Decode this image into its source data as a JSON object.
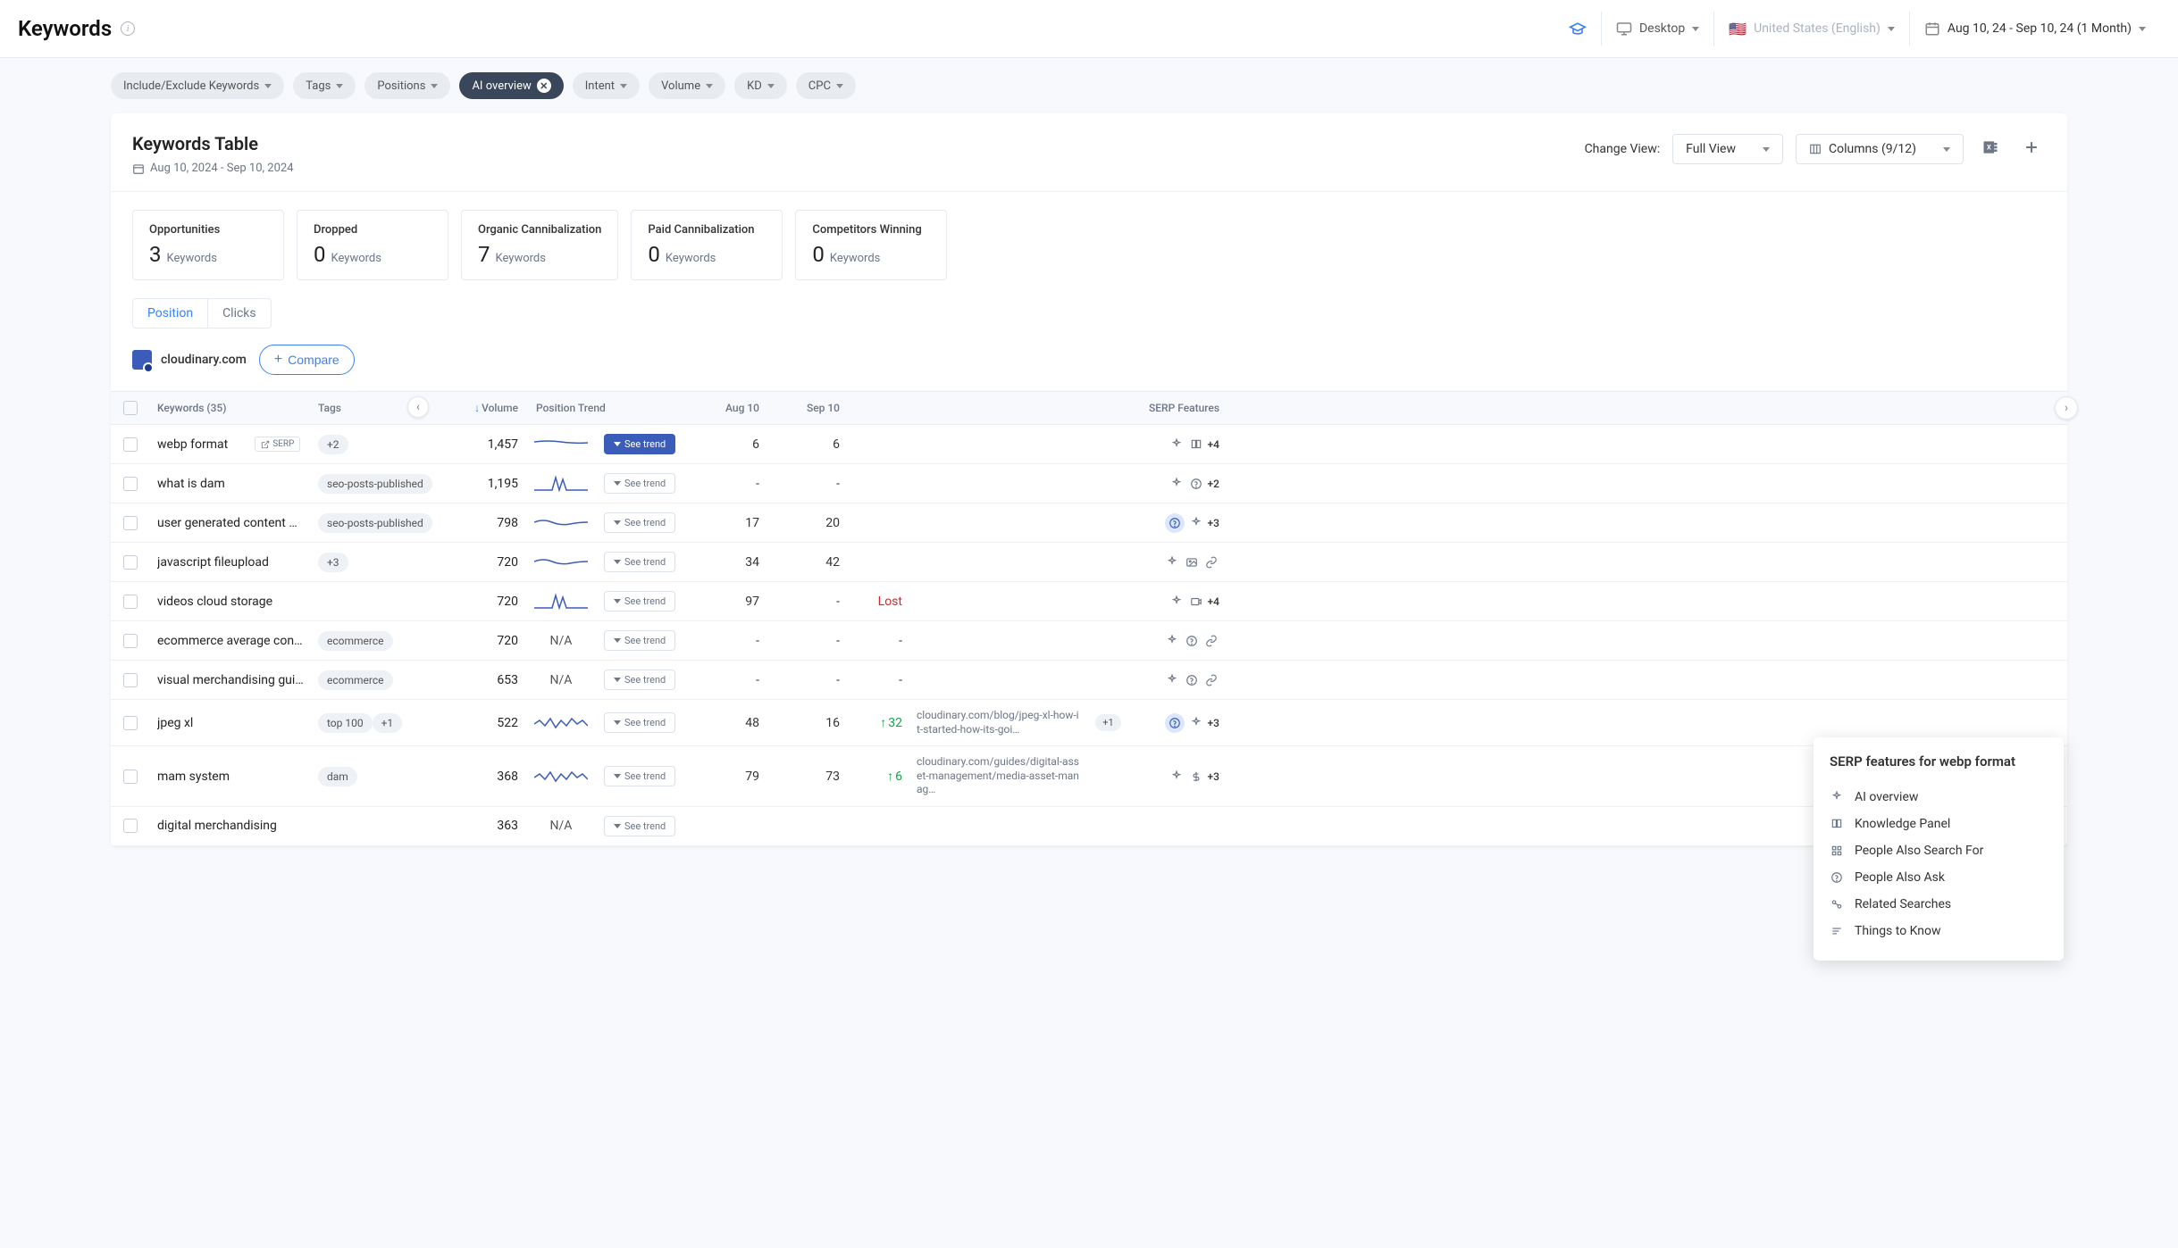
{
  "header": {
    "title": "Keywords",
    "device": "Desktop",
    "locale": "United States (English)",
    "dateRange": "Aug 10, 24 - Sep 10, 24 (1 Month)"
  },
  "filters": [
    {
      "label": "Include/Exclude Keywords",
      "active": false,
      "dropdown": true
    },
    {
      "label": "Tags",
      "active": false,
      "dropdown": true
    },
    {
      "label": "Positions",
      "active": false,
      "dropdown": true
    },
    {
      "label": "AI overview",
      "active": true,
      "dropdown": false
    },
    {
      "label": "Intent",
      "active": false,
      "dropdown": true
    },
    {
      "label": "Volume",
      "active": false,
      "dropdown": true
    },
    {
      "label": "KD",
      "active": false,
      "dropdown": true
    },
    {
      "label": "CPC",
      "active": false,
      "dropdown": true
    }
  ],
  "panel": {
    "title": "Keywords Table",
    "dateRange": "Aug 10, 2024 - Sep 10, 2024",
    "changeViewLabel": "Change View:",
    "viewMode": "Full View",
    "columnsLabel": "Columns (9/12)"
  },
  "stats": [
    {
      "label": "Opportunities",
      "value": "3",
      "unit": "Keywords"
    },
    {
      "label": "Dropped",
      "value": "0",
      "unit": "Keywords"
    },
    {
      "label": "Organic Cannibalization",
      "value": "7",
      "unit": "Keywords"
    },
    {
      "label": "Paid Cannibalization",
      "value": "0",
      "unit": "Keywords"
    },
    {
      "label": "Competitors Winning",
      "value": "0",
      "unit": "Keywords"
    }
  ],
  "tabs": {
    "position": "Position",
    "clicks": "Clicks"
  },
  "domain": {
    "name": "cloudinary.com",
    "compareLabel": "Compare"
  },
  "columns": {
    "keywords": "Keywords (35)",
    "tags": "Tags",
    "volume": "Volume",
    "positionTrend": "Position Trend",
    "aug": "Aug 10",
    "sep": "Sep 10",
    "serpFeatures": "SERP Features"
  },
  "seeTrendLabel": "See trend",
  "serpLinkLabel": "SERP",
  "rows": [
    {
      "kw": "webp format",
      "serpLink": true,
      "tags": [
        "+2"
      ],
      "vol": "1,457",
      "spark": "flat",
      "primaryTrend": true,
      "aug": "6",
      "sep": "6",
      "diff": "",
      "url": "",
      "more": "",
      "serp": [
        "sparkle",
        "book"
      ],
      "serpMore": "+4"
    },
    {
      "kw": "what is dam",
      "tags": [
        "seo-posts-published"
      ],
      "vol": "1,195",
      "spark": "spike",
      "aug": "-",
      "sep": "-",
      "diff": "",
      "url": "",
      "more": "",
      "serp": [
        "sparkle",
        "q"
      ],
      "serpMore": "+2"
    },
    {
      "kw": "user generated content exa…",
      "tags": [
        "seo-posts-published"
      ],
      "vol": "798",
      "spark": "wave",
      "aug": "17",
      "sep": "20",
      "diff": "",
      "url": "",
      "more": "",
      "serp": [
        "qhl",
        "sparkle"
      ],
      "serpMore": "+3"
    },
    {
      "kw": "javascript fileupload",
      "tags": [
        "+3"
      ],
      "vol": "720",
      "spark": "wave",
      "aug": "34",
      "sep": "42",
      "diff": "",
      "url": "",
      "more": "",
      "serp": [
        "sparkle",
        "img",
        "link"
      ],
      "serpMore": ""
    },
    {
      "kw": "videos cloud storage",
      "tags": [],
      "vol": "720",
      "spark": "spike",
      "aug": "97",
      "sep": "-",
      "diff": "Lost",
      "url": "",
      "more": "",
      "serp": [
        "sparkle",
        "video"
      ],
      "serpMore": "+4"
    },
    {
      "kw": "ecommerce average conve…",
      "tags": [
        "ecommerce"
      ],
      "vol": "720",
      "spark": "",
      "trendText": "N/A",
      "aug": "-",
      "sep": "-",
      "diff": "-",
      "url": "",
      "more": "",
      "serp": [
        "sparkle",
        "q",
        "link"
      ],
      "serpMore": ""
    },
    {
      "kw": "visual merchandising guide…",
      "tags": [
        "ecommerce"
      ],
      "vol": "653",
      "spark": "",
      "trendText": "N/A",
      "aug": "-",
      "sep": "-",
      "diff": "-",
      "url": "",
      "more": "",
      "serp": [
        "sparkle",
        "q",
        "link"
      ],
      "serpMore": ""
    },
    {
      "kw": "jpeg xl",
      "tags": [
        "top 100",
        "+1"
      ],
      "vol": "522",
      "spark": "wavy",
      "aug": "48",
      "sep": "16",
      "diff": "32",
      "url": "cloudinary.com/blog/jpeg-xl-how-it-started-how-its-goi…",
      "more": "+1",
      "serp": [
        "qhl",
        "sparkle"
      ],
      "serpMore": "+3"
    },
    {
      "kw": "mam system",
      "tags": [
        "dam"
      ],
      "vol": "368",
      "spark": "wavy",
      "aug": "79",
      "sep": "73",
      "diff": "6",
      "url": "cloudinary.com/guides/digital-asset-management/media-asset-manag…",
      "more": "",
      "serp": [
        "sparkle",
        "dollar"
      ],
      "serpMore": "+3"
    },
    {
      "kw": "digital merchandising",
      "tags": [],
      "vol": "363",
      "spark": "",
      "trendText": "N/A",
      "aug": "",
      "sep": "",
      "diff": "",
      "url": "",
      "more": "",
      "serp": [],
      "serpMore": ""
    }
  ],
  "popover": {
    "title": "SERP features for webp format",
    "items": [
      {
        "icon": "sparkle",
        "label": "AI overview"
      },
      {
        "icon": "book",
        "label": "Knowledge Panel"
      },
      {
        "icon": "grid",
        "label": "People Also Search For"
      },
      {
        "icon": "q",
        "label": "People Also Ask"
      },
      {
        "icon": "related",
        "label": "Related Searches"
      },
      {
        "icon": "list",
        "label": "Things to Know"
      }
    ]
  }
}
